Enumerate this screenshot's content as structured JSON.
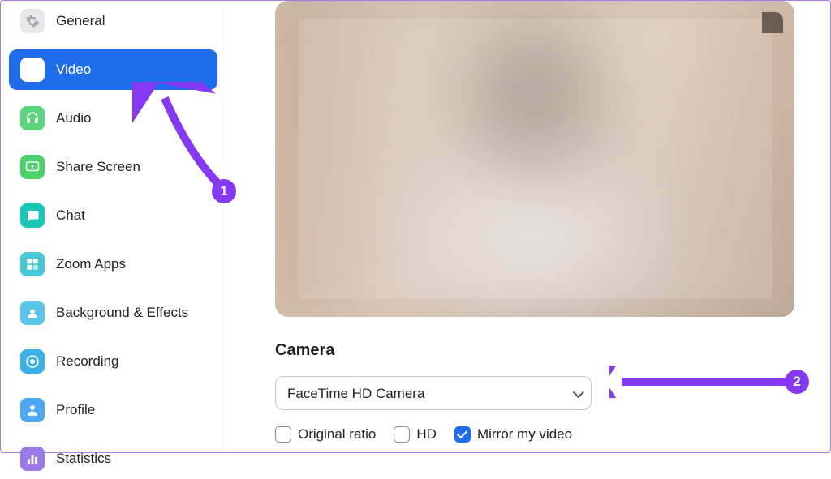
{
  "sidebar": {
    "items": [
      {
        "label": "General",
        "icon": "gear-icon",
        "active": false
      },
      {
        "label": "Video",
        "icon": "video-icon",
        "active": true
      },
      {
        "label": "Audio",
        "icon": "headphones-icon",
        "active": false
      },
      {
        "label": "Share Screen",
        "icon": "share-screen-icon",
        "active": false
      },
      {
        "label": "Chat",
        "icon": "chat-icon",
        "active": false
      },
      {
        "label": "Zoom Apps",
        "icon": "apps-icon",
        "active": false
      },
      {
        "label": "Background & Effects",
        "icon": "background-icon",
        "active": false
      },
      {
        "label": "Recording",
        "icon": "recording-icon",
        "active": false
      },
      {
        "label": "Profile",
        "icon": "profile-icon",
        "active": false
      },
      {
        "label": "Statistics",
        "icon": "statistics-icon",
        "active": false
      }
    ]
  },
  "main": {
    "camera_section_title": "Camera",
    "camera_select_value": "FaceTime HD Camera",
    "checkboxes": {
      "original_ratio": {
        "label": "Original ratio",
        "checked": false
      },
      "hd": {
        "label": "HD",
        "checked": false
      },
      "mirror": {
        "label": "Mirror my video",
        "checked": true
      }
    }
  },
  "annotations": {
    "badge1": "1",
    "badge2": "2"
  }
}
